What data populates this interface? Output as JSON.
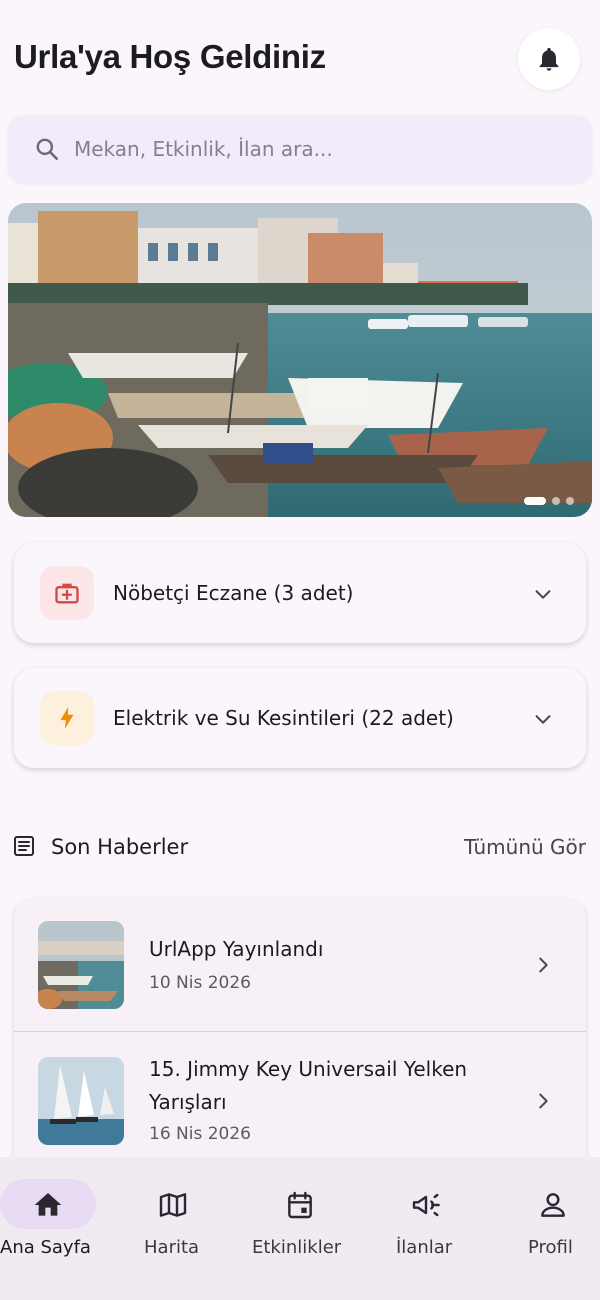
{
  "header": {
    "title": "Urla'ya Hoş Geldiniz"
  },
  "search": {
    "placeholder": "Mekan, Etkinlik, İlan ara..."
  },
  "banner": {
    "slide_count": 3,
    "active_slide": 1
  },
  "accordions": [
    {
      "label": "Nöbetçi Eczane (3 adet)",
      "icon": "first-aid-kit-icon",
      "icon_bg": "#fde6e8",
      "icon_color": "#d14a4a"
    },
    {
      "label": "Elektrik ve Su Kesintileri (22 adet)",
      "icon": "lightning-bolt-icon",
      "icon_bg": "#fdf0dc",
      "icon_color": "#f08c0a"
    }
  ],
  "news_section": {
    "title": "Son Haberler",
    "see_all": "Tümünü Gör",
    "items": [
      {
        "title": "UrlApp Yayınlandı",
        "date": "10 Nis 2026"
      },
      {
        "title": "15. Jimmy Key Universail Yelken Yarışları",
        "date": "16 Nis 2026"
      }
    ]
  },
  "bottom_nav": {
    "items": [
      {
        "label": "Ana Sayfa",
        "icon": "home-icon",
        "active": true
      },
      {
        "label": "Harita",
        "icon": "map-icon",
        "active": false
      },
      {
        "label": "Etkinlikler",
        "icon": "calendar-icon",
        "active": false
      },
      {
        "label": "İlanlar",
        "icon": "megaphone-icon",
        "active": false
      },
      {
        "label": "Profil",
        "icon": "person-icon",
        "active": false
      }
    ]
  },
  "colors": {
    "background": "#fbf6fb",
    "accent": "#e7dcf4",
    "search_bg": "#f2ebfa"
  }
}
